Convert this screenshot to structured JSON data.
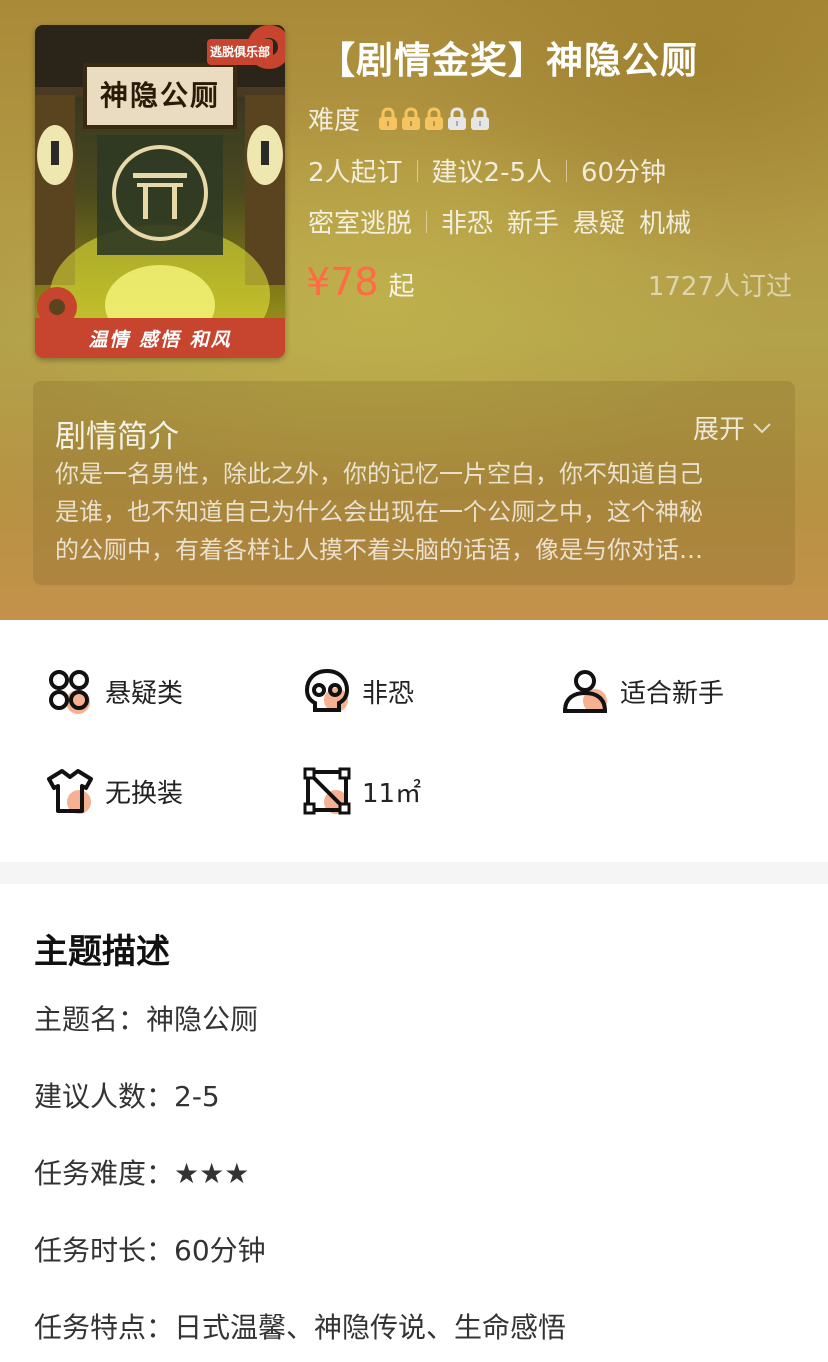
{
  "poster": {
    "logo_text": "逃脱俱乐部",
    "sign_text": "神隐公厕",
    "banner_text": "温情 感悟 和风"
  },
  "theme": {
    "title": "【剧情金奖】神隐公厕",
    "difficulty_label": "难度",
    "difficulty_level": 3,
    "difficulty_max": 5,
    "booking_info": [
      "2人起订",
      "建议2-5人",
      "60分钟"
    ],
    "tags": [
      "密室逃脱",
      "非恐",
      "新手",
      "悬疑",
      "机械"
    ],
    "price_symbol": "¥",
    "price": "78",
    "price_suffix": "起",
    "booked_count": "1727人订过"
  },
  "synopsis": {
    "title": "剧情简介",
    "expand_label": "展开",
    "lines": [
      "你是一名男性，除此之外，你的记忆一片空白，你不知道自己",
      "是谁，也不知道自己为什么会出现在一个公厕之中，这个神秘",
      "的公厕中，有着各样让人摸不着头脑的话语，像是与你对话…"
    ]
  },
  "features": [
    {
      "label": "悬疑类",
      "icon": "grid-icon"
    },
    {
      "label": "非恐",
      "icon": "skull-icon"
    },
    {
      "label": "适合新手",
      "icon": "user-icon"
    },
    {
      "label": "无换装",
      "icon": "shirt-icon"
    },
    {
      "label": "11㎡",
      "icon": "area-icon"
    }
  ],
  "description": {
    "title": "主题描述",
    "rows": [
      {
        "label": "主题名：",
        "value": "神隐公厕"
      },
      {
        "label": "建议人数：",
        "value": "2-5"
      },
      {
        "label": "任务难度：",
        "value": "★★★"
      },
      {
        "label": "任务时长：",
        "value": "60分钟"
      },
      {
        "label": "任务特点：",
        "value": "日式温馨、神隐传说、生命感悟"
      }
    ]
  },
  "colors": {
    "accent": "#ff6b45",
    "lock_active": "#f5c45e",
    "lock_inactive": "#e6e6e6",
    "icon_accent": "#f4a27f"
  }
}
